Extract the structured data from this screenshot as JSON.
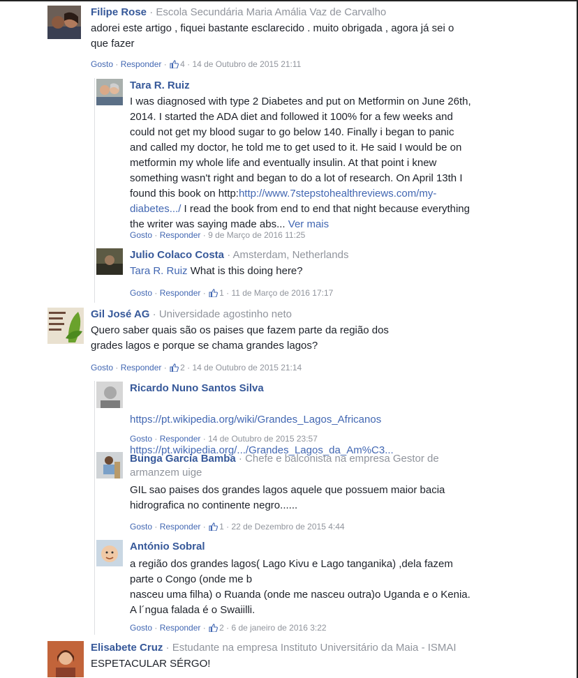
{
  "actions": {
    "like": "Gosto",
    "reply": "Responder",
    "see_more": "Ver mais"
  },
  "comments": [
    {
      "author": "Filipe Rose",
      "affiliation": "Escola Secundária Maria Amália Vaz de Carvalho",
      "text": "adorei este artigo , fiquei bastante esclarecido . muito obrigada , agora já sei o\nque fazer",
      "likes": "4",
      "date": "14 de Outubro de 2015 21:11"
    },
    {
      "author": "Tara R. Ruiz",
      "text_before_link": "I was diagnosed with type 2 Diabetes and put on Metformin on June 26th,\n2014. I started the ADA diet and followed it 100% for a few weeks and\ncould not get my blood sugar to go below 140. Finally i began to panic\nand called my doctor, he told me to get used to it. He said I would be on\nmetformin my whole life and eventually insulin. At that point i knew\nsomething wasn't right and began to do a lot of research. On April 13th I\nfound this book on http:",
      "link_text": "http://www.7stepstohealthreviews.com/my-\ndiabetes.../",
      "text_after_link": " I read the book from end to end that night because everything\nthe writer was saying made abs...",
      "date": "9 de Março de 2016 11:25"
    },
    {
      "author": "Julio Colaco Costa",
      "affiliation": "Amsterdam, Netherlands",
      "mention": "Tara R. Ruiz",
      "text": " What is this doing here?",
      "likes": "1",
      "date": "11 de Março de 2016 17:17"
    },
    {
      "author": "Gil José AG",
      "affiliation": "Universidade agostinho neto",
      "text": "Quero saber quais são os paises que fazem parte da região dos\ngrades lagos e porque se chama grandes lagos?",
      "likes": "2",
      "date": "14 de Outubro de 2015 21:14"
    },
    {
      "author": "Ricardo Nuno Santos Silva",
      "link1": "https://pt.wikipedia.org/wiki/Grandes_Lagos_Africanos",
      "link2": "https://pt.wikipedia.org/.../Grandes_Lagos_da_Am%C3...",
      "date": "14 de Outubro de 2015 23:57"
    },
    {
      "author": "Bunga Garcia Bamba",
      "affiliation_line1": "Chefe e balconista na empresa Gestor de",
      "affiliation_line2": "armanzem uige",
      "text": "GIL sao paises dos grandes lagos aquele que possuem maior bacia\nhidrografica no continente negro......",
      "likes": "1",
      "date": "22 de Dezembro de 2015 4:44"
    },
    {
      "author": "António Sobral",
      "text": "a região dos grandes lagos( Lago Kivu e Lago tanganika) ,dela fazem\nparte o Congo (onde me b\nnasceu uma filha) o Ruanda (onde me nasceu outra)o Uganda e o Kenia.\nA l´ngua falada é o Swaiilli.",
      "likes": "2",
      "date": "6 de janeiro de 2016 3:22"
    },
    {
      "author": "Elisabete Cruz",
      "affiliation": "Estudante na empresa Instituto Universitário da Maia - ISMAI",
      "text": "ESPETACULAR SÉRGO!"
    }
  ],
  "colors": {
    "author": "#365899",
    "link": "#4267b2",
    "meta": "#90949c",
    "text": "#1d2129"
  }
}
